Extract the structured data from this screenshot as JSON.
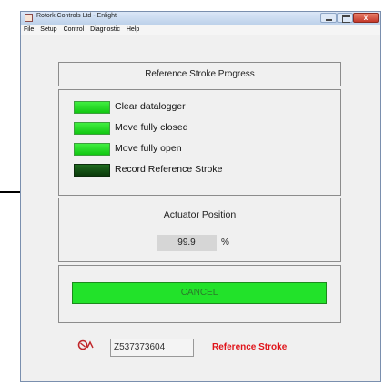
{
  "window": {
    "title": "Rotork Controls Ltd - Enlight",
    "close_glyph": "x"
  },
  "menu": [
    "File",
    "Setup",
    "Control",
    "Diagnostic",
    "Help"
  ],
  "header": {
    "title": "Reference Stroke Progress"
  },
  "steps": [
    {
      "label": "Clear datalogger",
      "state": "complete",
      "led_color": "#22dd22"
    },
    {
      "label": "Move fully closed",
      "state": "complete",
      "led_color": "#22dd22"
    },
    {
      "label": "Move fully open",
      "state": "complete",
      "led_color": "#22dd22"
    },
    {
      "label": "Record Reference Stroke",
      "state": "pending",
      "led_color": "#0a3a0a"
    }
  ],
  "position": {
    "title": "Actuator Position",
    "value": "99.9",
    "unit": "%"
  },
  "cancel": {
    "label": "CANCEL",
    "color": "#22e22a"
  },
  "footer": {
    "status_icon": "actuator-link-icon",
    "serial": "Z537373604",
    "mode": "Reference Stroke",
    "mode_color": "#e0141a"
  }
}
